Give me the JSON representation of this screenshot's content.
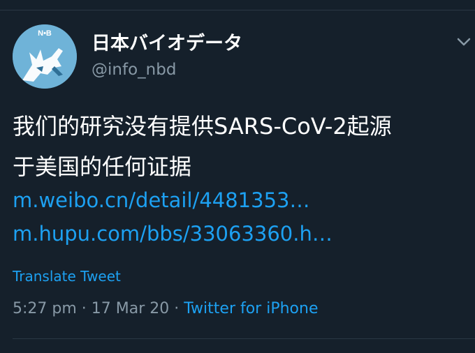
{
  "colors": {
    "background": "#15202b",
    "text_primary": "#ffffff",
    "text_secondary": "#8899a6",
    "link": "#1da1f2",
    "avatar_bg": "#6fb3d8"
  },
  "author": {
    "display_name": "日本バイオデータ",
    "handle": "@info_nbd",
    "avatar_icon": "bird-logo-avatar",
    "avatar_text": "N•B"
  },
  "menu_icon": "chevron-down-icon",
  "tweet": {
    "text_lines": [
      "我们的研究没有提供SARS-CoV-2起源",
      "于美国的任何证据"
    ],
    "links": [
      "m.weibo.cn/detail/4481353…",
      "m.hupu.com/bbs/33063360.h…"
    ],
    "translate_label": "Translate Tweet"
  },
  "meta": {
    "time": "5:27 pm",
    "separator": " · ",
    "date": "17 Mar 20",
    "source": "Twitter for iPhone"
  }
}
